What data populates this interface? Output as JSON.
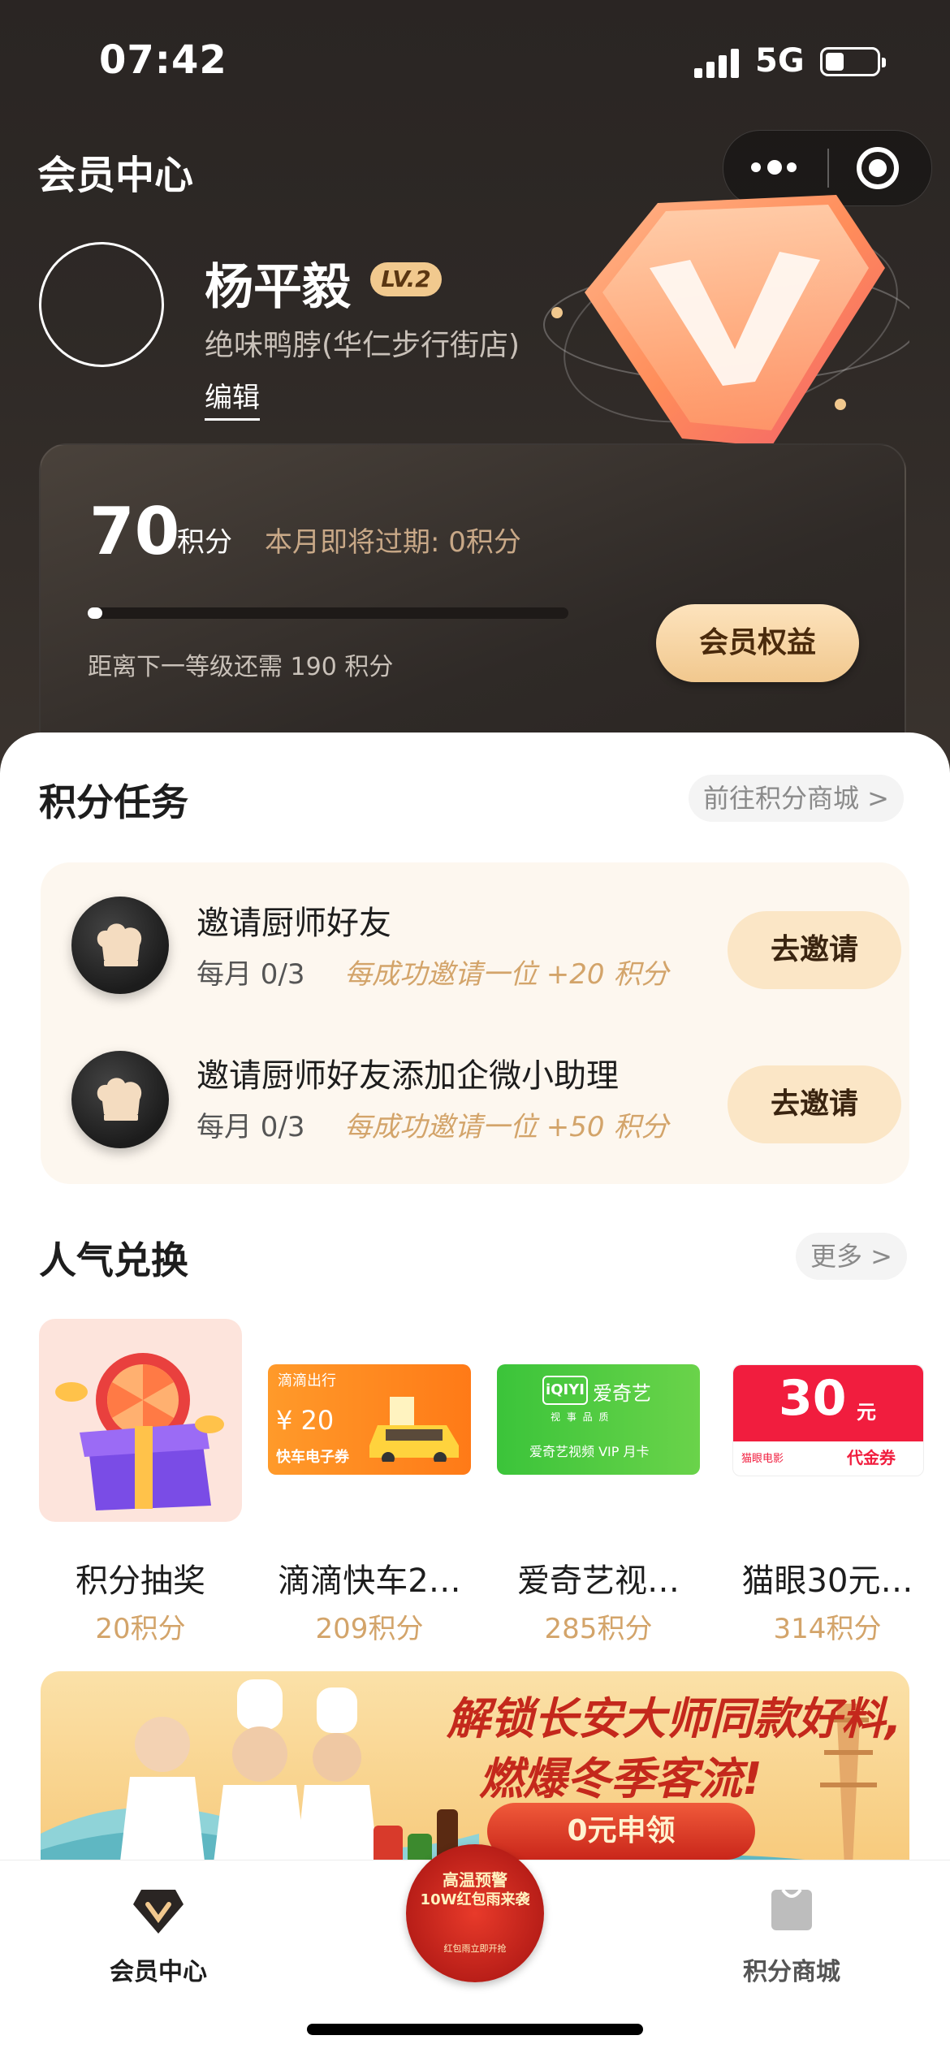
{
  "status_bar": {
    "time": "07:42",
    "network": "5G"
  },
  "header": {
    "title": "会员中心"
  },
  "profile": {
    "name": "杨平毅",
    "level": "LV.2",
    "store": "绝味鸭脖(华仁步行街店)",
    "edit_label": "编辑"
  },
  "points_card": {
    "points": "70",
    "unit": "积分",
    "expire_text": "本月即将过期: 0积分",
    "progress_fraction": 0.03,
    "next_level_text": "距离下一等级还需 190 积分",
    "benefit_button": "会员权益"
  },
  "tasks": {
    "title": "积分任务",
    "link": "前往积分商城 >",
    "items": [
      {
        "title": "邀请厨师好友",
        "count": "每月 0/3",
        "reward": "每成功邀请一位 +20 积分",
        "button": "去邀请"
      },
      {
        "title": "邀请厨师好友添加企微小助理",
        "count": "每月 0/3",
        "reward": "每成功邀请一位 +50 积分",
        "button": "去邀请"
      }
    ]
  },
  "exchange": {
    "title": "人气兑换",
    "more": "更多 >",
    "items": [
      {
        "name": "积分抽奖",
        "points": "20积分"
      },
      {
        "name": "滴滴快车2…",
        "points": "209积分",
        "card_brand": "滴滴出行",
        "card_value": "¥ 20",
        "card_caption": "快车电子券"
      },
      {
        "name": "爱奇艺视…",
        "points": "285积分",
        "card_brand": "爱奇艺",
        "card_logo": "iQIYI",
        "card_tag": "视 事 品 质",
        "card_caption": "爱奇艺视频 VIP 月卡"
      },
      {
        "name": "猫眼30元…",
        "points": "314积分",
        "card_value": "30",
        "card_unit": "元",
        "card_brand": "猫眼电影",
        "card_caption": "代金券"
      }
    ]
  },
  "banner": {
    "headline_1": "解锁长安大师同款好料,",
    "headline_2": "燃爆冬季客流!",
    "button": "0元申领"
  },
  "tabbar": {
    "home": "会员中心",
    "center_line1": "高温预警",
    "center_line2": "10W红包雨来袭",
    "center_line3": "红包雨立即开抢",
    "mall": "积分商城"
  },
  "colors": {
    "accent_gold": "#d3a46a",
    "button_gold": "#f1c88e",
    "header_bg": "#2a2523"
  }
}
